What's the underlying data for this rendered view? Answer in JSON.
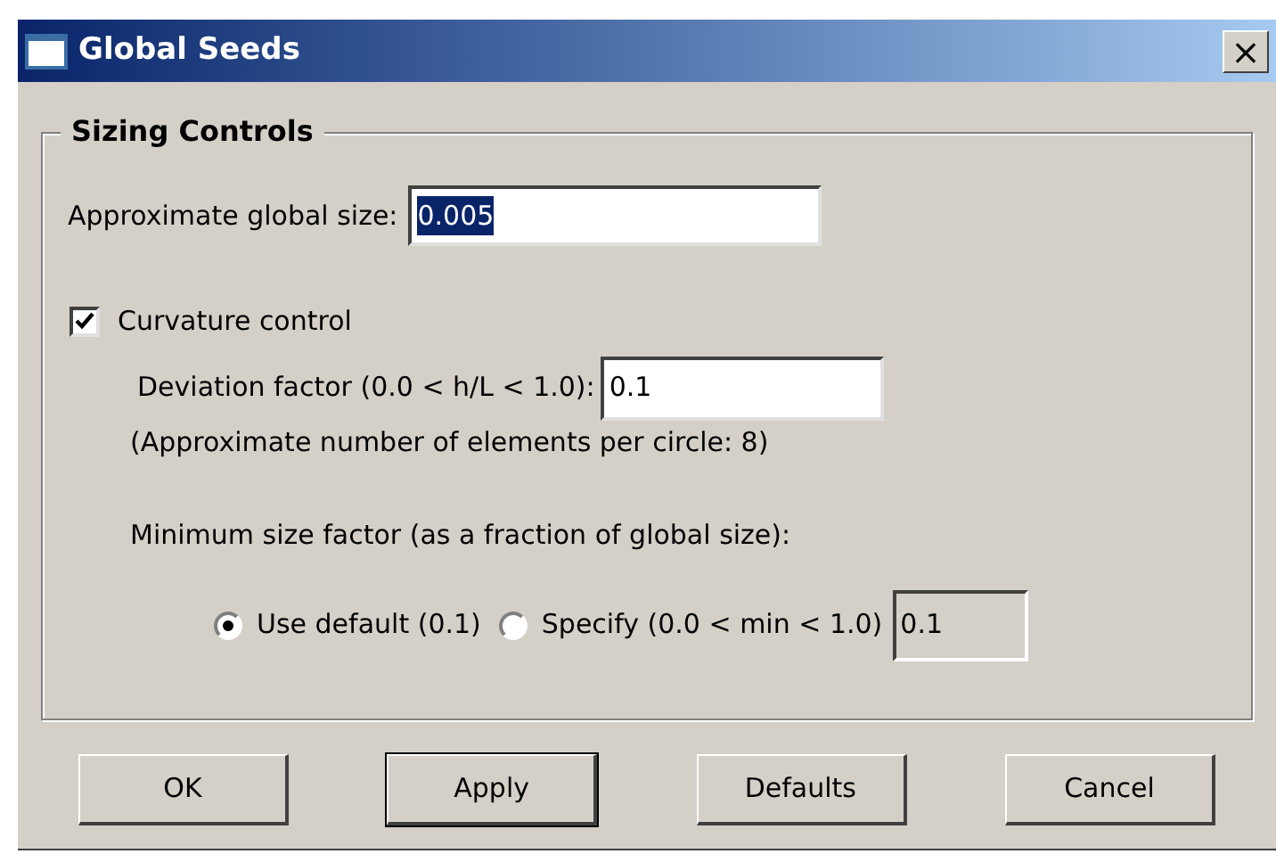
{
  "window": {
    "title": "Global Seeds",
    "close": "×"
  },
  "group": {
    "title": "Sizing Controls"
  },
  "global_size": {
    "label": "Approximate global size:",
    "value": "0.005",
    "value_selected": true
  },
  "curvature": {
    "label": "Curvature control",
    "checked": true
  },
  "deviation": {
    "label": "Deviation factor (0.0 < h/L < 1.0):",
    "value": "0.1"
  },
  "elements_note": "(Approximate number of elements per circle: 8)",
  "min_size": {
    "label": "Minimum size factor (as a fraction of global size):",
    "options": [
      {
        "label": "Use default (0.1)",
        "selected": true
      },
      {
        "label": "Specify (0.0 < min < 1.0)",
        "selected": false
      }
    ],
    "value": "0.1",
    "disabled": true
  },
  "buttons": [
    {
      "label": "OK",
      "default": false
    },
    {
      "label": "Apply",
      "default": true
    },
    {
      "label": "Defaults",
      "default": false
    },
    {
      "label": "Cancel",
      "default": false
    }
  ]
}
